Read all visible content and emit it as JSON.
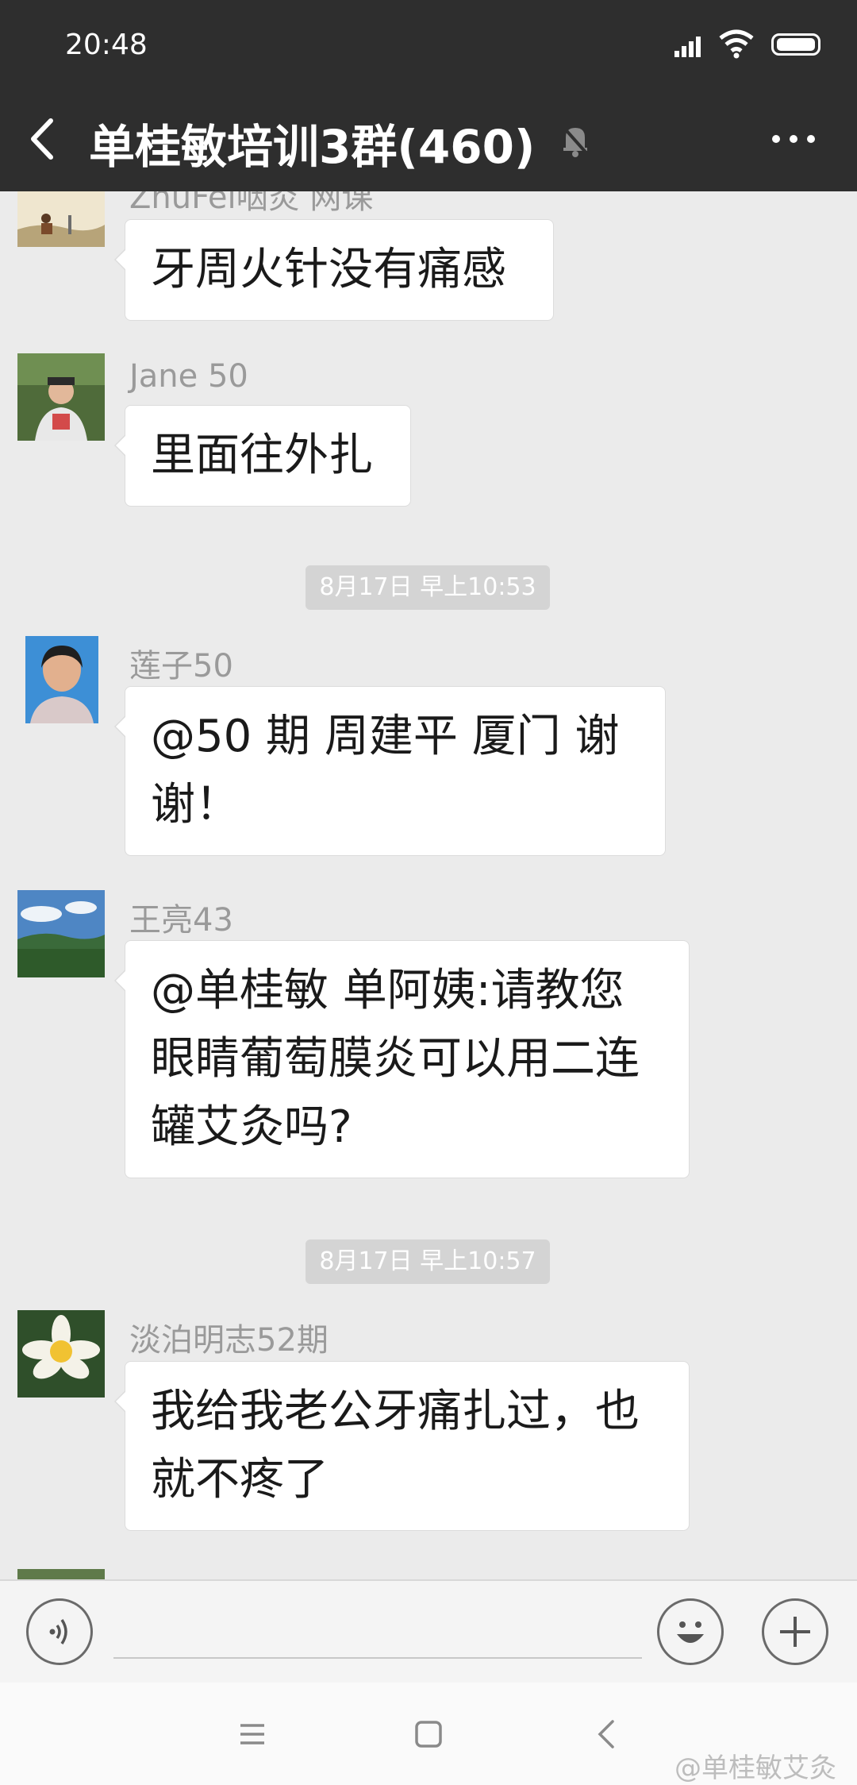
{
  "status_bar": {
    "time": "20:48"
  },
  "header": {
    "title": "单桂敏培训3群(460)"
  },
  "messages": [
    {
      "sender": "ZhuFei咽炎 网课",
      "text": "牙周火针没有痛感"
    },
    {
      "sender": "Jane  50",
      "text": "里面往外扎"
    },
    {
      "sender": "莲子50",
      "text": "@50 期 周建平 厦门  谢谢！"
    },
    {
      "sender": "王亮43",
      "text": "@单桂敏     单阿姨:请教您眼睛葡萄膜炎可以用二连罐艾灸吗?"
    },
    {
      "sender": "淡泊明志52期",
      "text": "我给我老公牙痛扎过，也就不疼了"
    }
  ],
  "timestamps": [
    "8月17日 早上10:53",
    "8月17日 早上10:57"
  ],
  "input": {
    "placeholder": ""
  },
  "watermark": "@单桂敏艾灸",
  "colors": {
    "header_bg": "#2e2e2e",
    "chat_bg": "#ebebeb",
    "bubble_bg": "#ffffff",
    "timestamp_bg": "#d4d4d4"
  },
  "icons": [
    "back-arrow-icon",
    "mute-bell-icon",
    "more-icon",
    "voice-icon",
    "emoji-icon",
    "plus-icon",
    "menu-icon",
    "home-icon",
    "back-nav-icon",
    "signal-icon",
    "wifi-icon",
    "battery-icon"
  ]
}
